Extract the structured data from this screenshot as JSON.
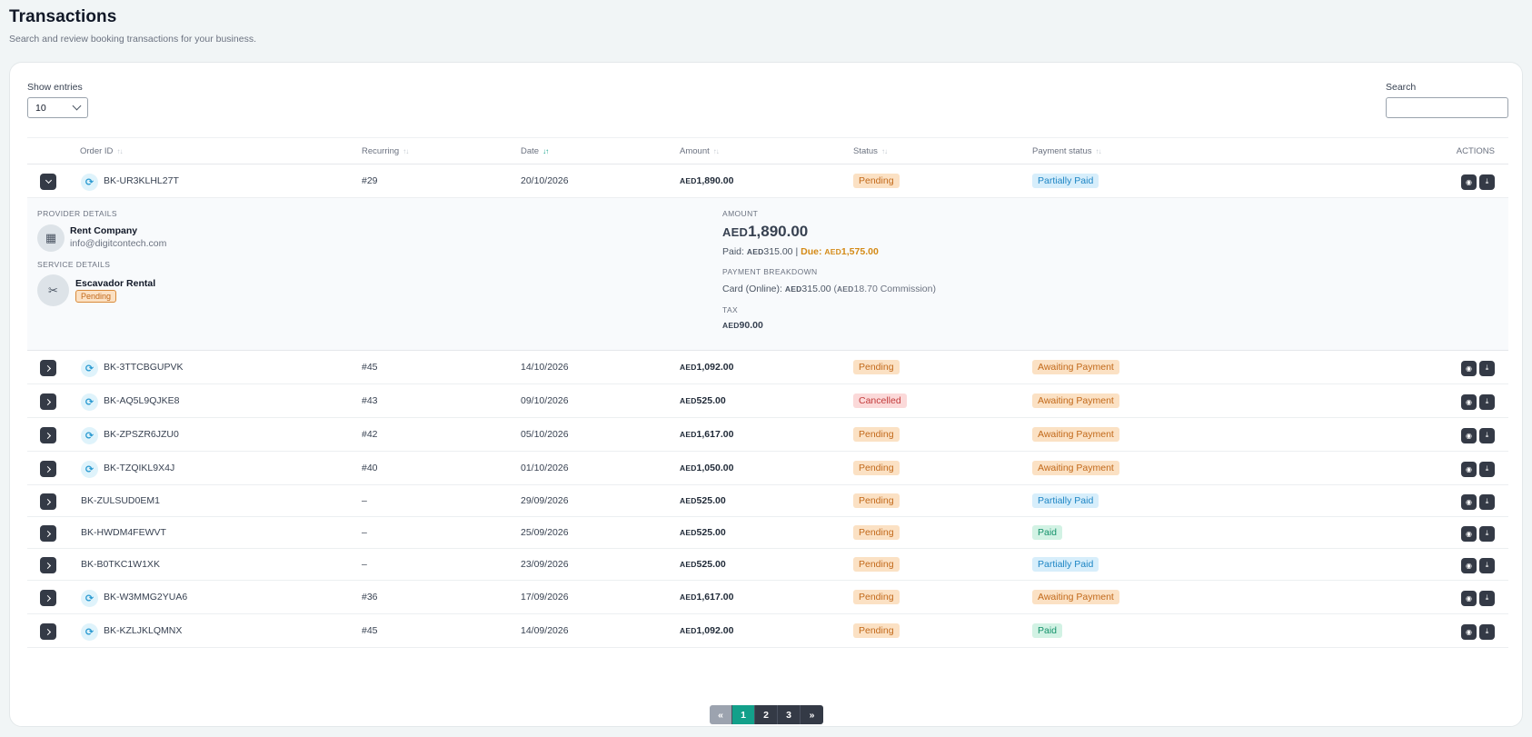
{
  "header": {
    "title": "Transactions",
    "subtitle": "Search and review booking transactions for your business."
  },
  "controls": {
    "show_entries_label": "Show entries",
    "show_entries_value": "10",
    "search_label": "Search",
    "search_placeholder": ""
  },
  "table": {
    "columns": {
      "order_id": "Order ID",
      "recurring": "Recurring",
      "date": "Date",
      "amount": "Amount",
      "status": "Status",
      "payment_status": "Payment status",
      "actions": "ACTIONS"
    },
    "currency": "AED",
    "rows": [
      {
        "order_id": "BK-UR3KLHL27T",
        "recurring": "#29",
        "date": "20/10/2026",
        "amount": "1,890.00",
        "status": "Pending",
        "payment_status": "Partially Paid",
        "expanded": true,
        "has_recurring_icon": true
      },
      {
        "order_id": "BK-3TTCBGUPVK",
        "recurring": "#45",
        "date": "14/10/2026",
        "amount": "1,092.00",
        "status": "Pending",
        "payment_status": "Awaiting Payment",
        "has_recurring_icon": true
      },
      {
        "order_id": "BK-AQ5L9QJKE8",
        "recurring": "#43",
        "date": "09/10/2026",
        "amount": "525.00",
        "status": "Cancelled",
        "payment_status": "Awaiting Payment",
        "has_recurring_icon": true
      },
      {
        "order_id": "BK-ZPSZR6JZU0",
        "recurring": "#42",
        "date": "05/10/2026",
        "amount": "1,617.00",
        "status": "Pending",
        "payment_status": "Awaiting Payment",
        "has_recurring_icon": true
      },
      {
        "order_id": "BK-TZQIKL9X4J",
        "recurring": "#40",
        "date": "01/10/2026",
        "amount": "1,050.00",
        "status": "Pending",
        "payment_status": "Awaiting Payment",
        "has_recurring_icon": true
      },
      {
        "order_id": "BK-ZULSUD0EM1",
        "recurring": "–",
        "date": "29/09/2026",
        "amount": "525.00",
        "status": "Pending",
        "payment_status": "Partially Paid",
        "has_recurring_icon": false
      },
      {
        "order_id": "BK-HWDM4FEWVT",
        "recurring": "–",
        "date": "25/09/2026",
        "amount": "525.00",
        "status": "Pending",
        "payment_status": "Paid",
        "has_recurring_icon": false
      },
      {
        "order_id": "BK-B0TKC1W1XK",
        "recurring": "–",
        "date": "23/09/2026",
        "amount": "525.00",
        "status": "Pending",
        "payment_status": "Partially Paid",
        "has_recurring_icon": false
      },
      {
        "order_id": "BK-W3MMG2YUA6",
        "recurring": "#36",
        "date": "17/09/2026",
        "amount": "1,617.00",
        "status": "Pending",
        "payment_status": "Awaiting Payment",
        "has_recurring_icon": true
      },
      {
        "order_id": "BK-KZLJKLQMNX",
        "recurring": "#45",
        "date": "14/09/2026",
        "amount": "1,092.00",
        "status": "Pending",
        "payment_status": "Paid",
        "has_recurring_icon": true
      }
    ]
  },
  "details": {
    "provider_heading": "PROVIDER DETAILS",
    "provider_name": "Rent Company",
    "provider_email": "info@digitcontech.com",
    "service_heading": "SERVICE DETAILS",
    "service_name": "Escavador Rental",
    "service_status": "Pending",
    "amount_heading": "AMOUNT",
    "amount_total": "1,890.00",
    "paid_label": "Paid:",
    "paid_amount": "315.00",
    "separator": "|",
    "due_label": "Due:",
    "due_amount": "1,575.00",
    "breakdown_heading": "PAYMENT BREAKDOWN",
    "breakdown_method": "Card (Online):",
    "breakdown_amount": "315.00",
    "commission_amount": "18.70",
    "commission_label": "Commission",
    "tax_heading": "TAX",
    "tax_amount": "90.00"
  },
  "pagination": {
    "prev": "«",
    "pages": [
      "1",
      "2",
      "3"
    ],
    "active_page": "1",
    "next": "»"
  },
  "colors": {
    "accent": "#13a08a",
    "dark_button": "#343a46",
    "pending_bg": "#fbe1c4",
    "paid_bg": "#d2f2e4",
    "partial_bg": "#d7eefb",
    "cancelled_bg": "#fbd9d9"
  }
}
